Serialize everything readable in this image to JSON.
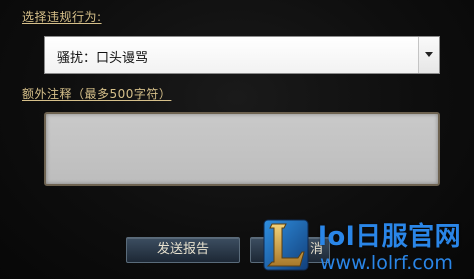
{
  "form": {
    "violation_label": "选择违规行为:",
    "violation_selected": "骚扰：口头谩骂",
    "notes_label": "额外注释（最多500字符）",
    "notes_value": ""
  },
  "buttons": {
    "submit_label": "发送报告",
    "cancel_label": "消"
  },
  "watermark": {
    "logo_letter": "L",
    "title": "lol日服官网",
    "url": "www.lolrf.com",
    "color": "#2a86e8"
  },
  "icons": {
    "dropdown_arrow": "caret-down-icon",
    "logo": "league-logo-icon"
  }
}
